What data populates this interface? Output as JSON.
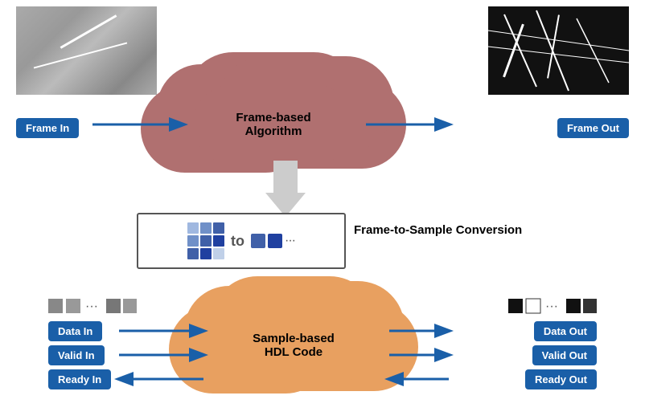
{
  "top_section": {
    "cloud_top_label": "Frame-based\nAlgorithm",
    "btn_frame_in": "Frame In",
    "btn_frame_out": "Frame Out"
  },
  "conversion": {
    "label": "Frame-to-Sample Conversion"
  },
  "bottom_section": {
    "cloud_bottom_label": "Sample-based\nHDL Code",
    "btn_data_in": "Data In",
    "btn_valid_in": "Valid In",
    "btn_ready_in": "Ready In",
    "btn_data_out": "Data Out",
    "btn_valid_out": "Valid Out",
    "btn_ready_out": "Ready Out"
  },
  "colors": {
    "btn_blue": "#1a5fa8",
    "cloud_top": "#b07070",
    "cloud_bottom": "#e8a060",
    "arrow": "#1a5fa8",
    "big_arrow": "#cccccc"
  }
}
